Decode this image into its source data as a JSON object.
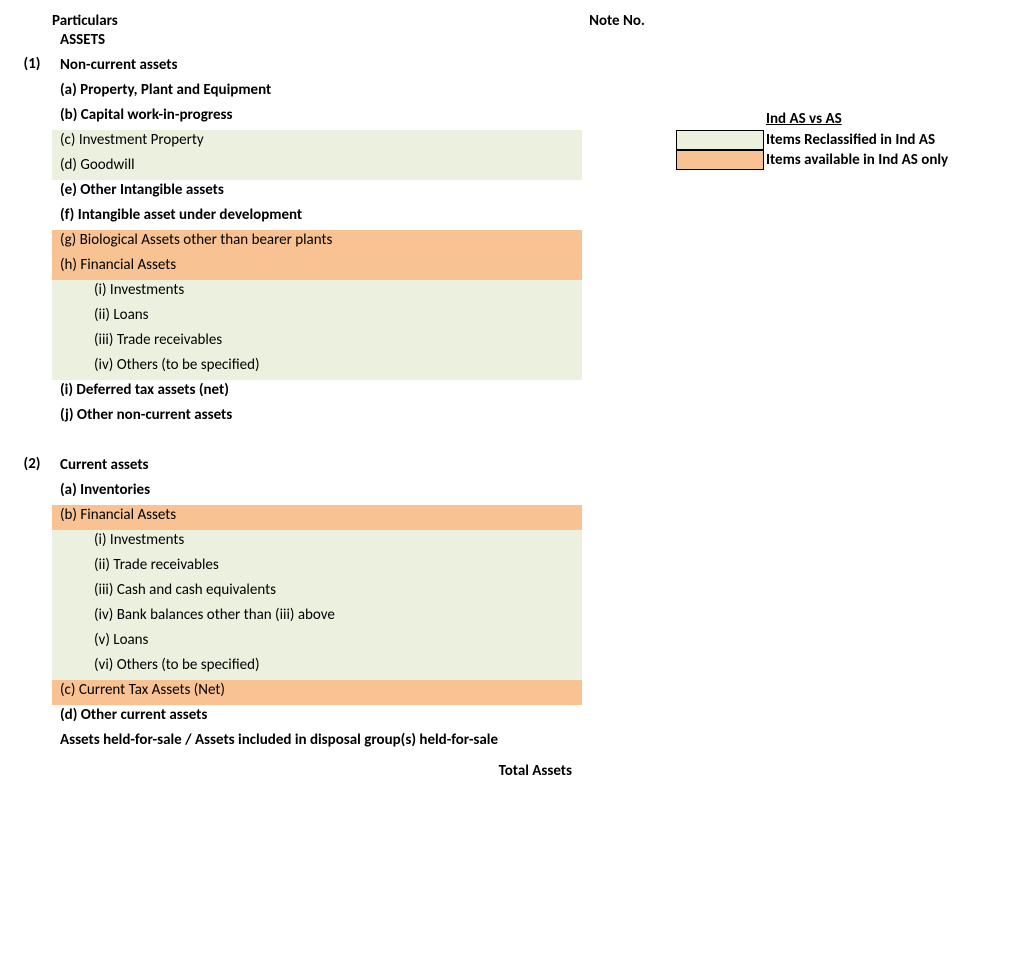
{
  "table": {
    "headers": {
      "particulars": "Particulars",
      "note": "Note No."
    },
    "sections": [
      {
        "idx": "(1)",
        "title_pre": "ASSETS",
        "title": "Non-current assets",
        "rows": [
          {
            "text": "(a) Property, Plant and Equipment",
            "bold": true,
            "hl": ""
          },
          {
            "text": "(b) Capital work-in-progress",
            "bold": true,
            "hl": ""
          },
          {
            "text": "(c) Investment Property",
            "bold": false,
            "hl": "green"
          },
          {
            "text": "(d) Goodwill",
            "bold": false,
            "hl": "green"
          },
          {
            "text": "(e) Other Intangible assets",
            "bold": true,
            "hl": ""
          },
          {
            "text": "(f) Intangible asset under development",
            "bold": true,
            "hl": ""
          },
          {
            "text": "(g) Biological Assets other than bearer plants",
            "bold": false,
            "hl": "orange"
          },
          {
            "text": "(h) Financial Assets",
            "bold": false,
            "hl": "orange"
          },
          {
            "text": "(i) Investments",
            "bold": false,
            "hl": "green",
            "sub": true
          },
          {
            "text": "(ii) Loans",
            "bold": false,
            "hl": "green",
            "sub": true
          },
          {
            "text": "(iii) Trade receivables",
            "bold": false,
            "hl": "green",
            "sub": true
          },
          {
            "text": "(iv) Others (to be specified)",
            "bold": false,
            "hl": "green",
            "sub": true
          },
          {
            "text": "(i) Deferred tax assets (net)",
            "bold": true,
            "hl": ""
          },
          {
            "text": "(j) Other non-current assets",
            "bold": true,
            "hl": ""
          }
        ]
      },
      {
        "idx": "(2)",
        "title": "Current assets",
        "rows": [
          {
            "text": "(a) Inventories",
            "bold": true,
            "hl": ""
          },
          {
            "text": "(b) Financial Assets",
            "bold": false,
            "hl": "orange"
          },
          {
            "text": "(i) Investments",
            "bold": false,
            "hl": "green",
            "sub": true
          },
          {
            "text": "(ii) Trade receivables",
            "bold": false,
            "hl": "green",
            "sub": true
          },
          {
            "text": "(iii) Cash and cash equivalents",
            "bold": false,
            "hl": "green",
            "sub": true
          },
          {
            "text": "(iv) Bank balances other than (iii) above",
            "bold": false,
            "hl": "green",
            "sub": true
          },
          {
            "text": "(v) Loans",
            "bold": false,
            "hl": "green",
            "sub": true
          },
          {
            "text": "(vi) Others (to be specified)",
            "bold": false,
            "hl": "green",
            "sub": true
          },
          {
            "text": "(c) Current Tax Assets (Net)",
            "bold": false,
            "hl": "orange"
          },
          {
            "text": "(d) Other current assets",
            "bold": true,
            "hl": ""
          },
          {
            "text": "Assets held-for-sale / Assets included in disposal group(s) held-for-sale",
            "bold": true,
            "hl": ""
          }
        ]
      }
    ],
    "total": "Total Assets"
  },
  "legend": {
    "title": "Ind AS vs AS",
    "items": [
      {
        "color": "green",
        "label": "Items Reclassified in Ind AS"
      },
      {
        "color": "orange",
        "label": "Items available in Ind AS only"
      }
    ]
  }
}
